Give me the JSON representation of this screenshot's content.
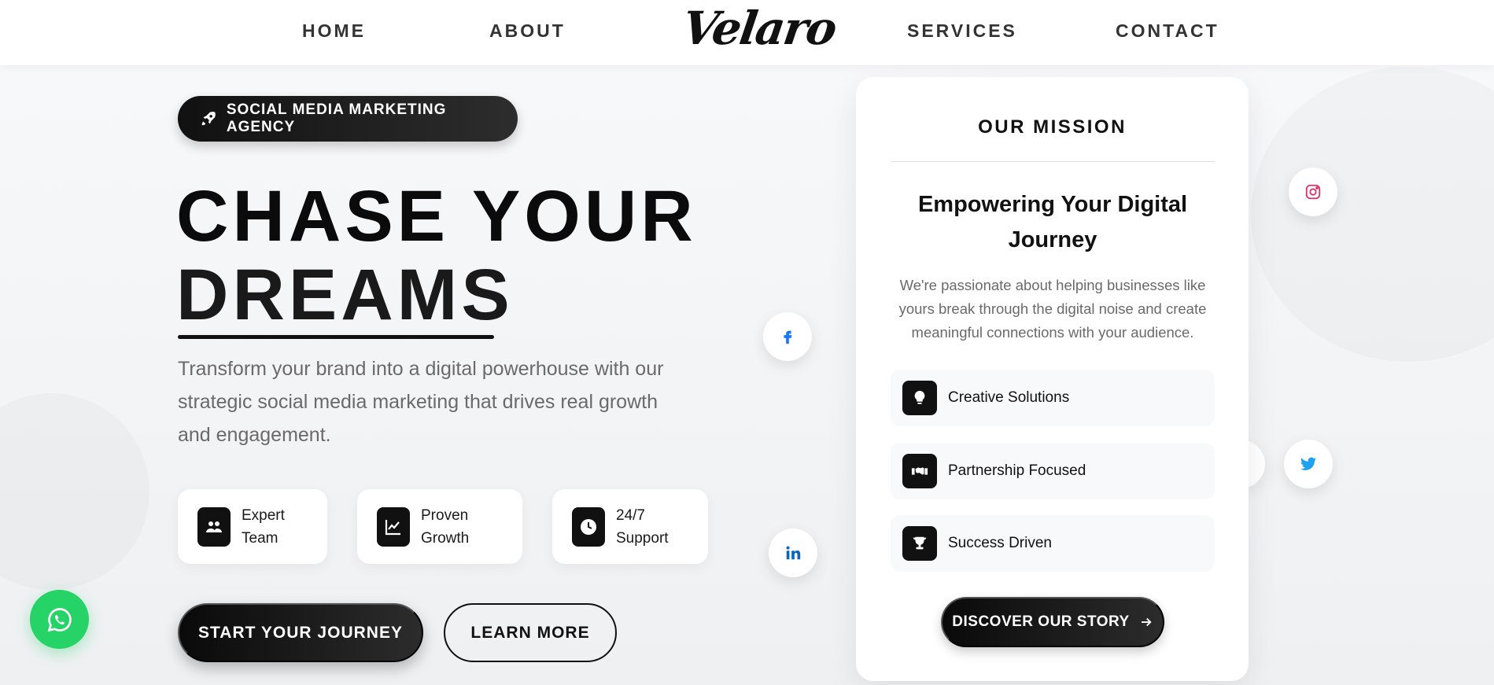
{
  "nav": {
    "home": "HOME",
    "about": "ABOUT",
    "logo": "Velaro",
    "services": "SERVICES",
    "contact": "CONTACT"
  },
  "hero": {
    "badge": "SOCIAL MEDIA MARKETING AGENCY",
    "title_line1": "CHASE YOUR",
    "title_line2": "DREAMS",
    "description": "Transform your brand into a digital powerhouse with our strategic social media marketing that drives real growth and engagement.",
    "features": [
      {
        "label": "Expert Team",
        "icon": "users-icon"
      },
      {
        "label": "Proven Growth",
        "icon": "chart-line-icon"
      },
      {
        "label": "24/7 Support",
        "icon": "clock-icon"
      }
    ],
    "primary_button": "START YOUR JOURNEY",
    "secondary_button": "LEARN MORE"
  },
  "mission": {
    "heading": "OUR MISSION",
    "title": "Empowering Your Digital Journey",
    "description": "We're passionate about helping businesses like yours break through the digital noise and create meaningful connections with your audience.",
    "items": [
      {
        "label": "Creative Solutions",
        "icon": "lightbulb-icon"
      },
      {
        "label": "Partnership Focused",
        "icon": "handshake-icon"
      },
      {
        "label": "Success Driven",
        "icon": "trophy-icon"
      }
    ],
    "button": "DISCOVER OUR STORY"
  },
  "colors": {
    "accent": "#111111",
    "whatsapp": "#25d366",
    "facebook": "#1877f2",
    "linkedin": "#0a66c2",
    "instagram": "#e1306c",
    "twitter": "#1da1f2"
  }
}
